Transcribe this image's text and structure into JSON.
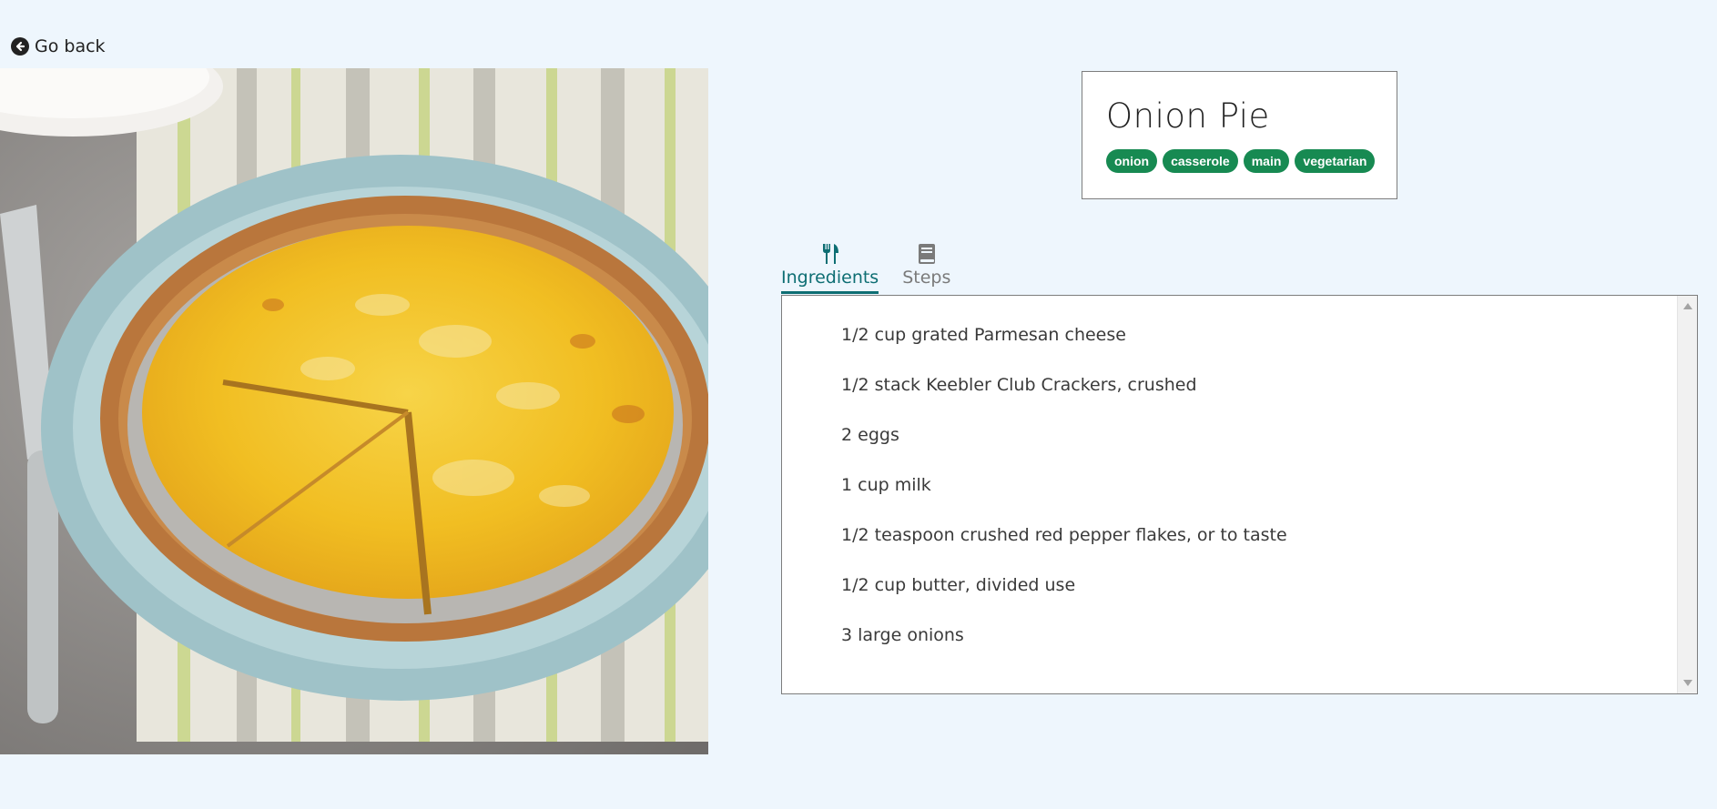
{
  "nav": {
    "back_label": "Go back"
  },
  "hero": {
    "alt": "Onion Pie"
  },
  "recipe": {
    "title": "Onion Pie",
    "tags": [
      "onion",
      "casserole",
      "main",
      "vegetarian"
    ]
  },
  "tabs": [
    {
      "label": "Ingredients",
      "icon": "utensils-icon",
      "active": true
    },
    {
      "label": "Steps",
      "icon": "book-icon",
      "active": false
    }
  ],
  "ingredients": [
    "1/2 cup grated Parmesan cheese",
    "1/2 stack Keebler Club Crackers, crushed",
    "2 eggs",
    "1 cup milk",
    "1/2 teaspoon crushed red pepper flakes, or to taste",
    "1/2 cup butter, divided use",
    "3 large onions"
  ],
  "colors": {
    "background": "#eef6fd",
    "tag": "#178a52",
    "active_tab": "#0e6e73",
    "inactive_tab": "#7a7a7a"
  }
}
